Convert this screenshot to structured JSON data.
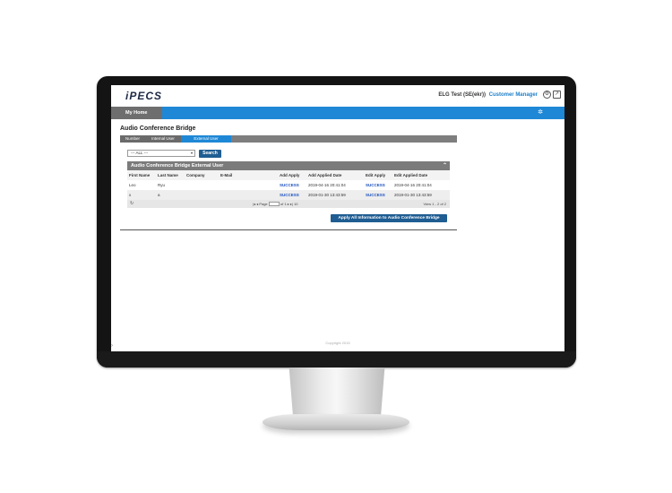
{
  "brand": {
    "logo_text": "iPECS"
  },
  "account": {
    "user": "ELG Test (SE(ekr))",
    "role": "Customer Manager"
  },
  "nav": {
    "home_label": "My Home"
  },
  "page": {
    "title": "Audio Conference Bridge"
  },
  "tabs": [
    {
      "label": "Number"
    },
    {
      "label": "Internal User"
    },
    {
      "label": "External User"
    }
  ],
  "filter": {
    "selected": "--- ALL ---",
    "search_label": "Search"
  },
  "grid": {
    "title": "Audio Conference Bridge External User",
    "columns": [
      "First Name",
      "Last Name",
      "Company",
      "E-Mail",
      "Add Apply",
      "Add Applied Date",
      "Edit Apply",
      "Edit Applied Date"
    ],
    "rows": [
      [
        "Leo",
        "Ryu",
        "",
        "",
        "SUCCESS",
        "2019-04-16 20:41:04",
        "SUCCESS",
        "2019-04-16 20:41:04"
      ],
      [
        "x",
        "a",
        "",
        "",
        "SUCCESS",
        "2019-01-30 13:43:59",
        "SUCCESS",
        "2019-01-30 13:43:59"
      ]
    ],
    "pager": {
      "page_label": "Page",
      "page_value": "1",
      "of_label": "of 1",
      "page_size": "10",
      "view_text": "View 1 - 2 of 2"
    }
  },
  "actions": {
    "apply_all_label": "Apply All Information to Audio Conference Bridge"
  },
  "footer": {
    "copyright": "Copyright 2015"
  },
  "colors": {
    "accent": "#1e88d6",
    "button": "#1f5d92",
    "header_gray": "#7b7b7b",
    "success": "#1a4fbf"
  },
  "icons": [
    "settings-icon",
    "exit-icon",
    "menu-toggle-icon",
    "refresh-icon",
    "collapse-icon"
  ]
}
